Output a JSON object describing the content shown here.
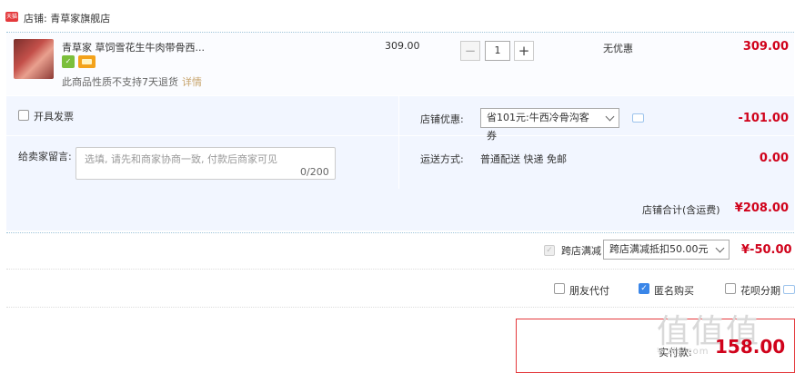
{
  "shop": {
    "icon": "shop-icon",
    "icon_text": "天猫",
    "name": "店铺: 青草家旗舰店"
  },
  "product": {
    "title": "青草家 草饲雪花生牛肉带骨西...",
    "return_note": "此商品性质不支持7天退货",
    "detail_link": "详情",
    "unit_price": "309.00",
    "quantity": "1",
    "minus": "−",
    "plus": "+",
    "discount": "无优惠",
    "row_total": "309.00"
  },
  "options": {
    "invoice_label": "开具发票",
    "shop_discount_label": "店铺优惠:",
    "shop_discount_value": "省101元:牛西冷骨沟客券",
    "shop_discount_amount": "-101.00",
    "message_label": "给卖家留言:",
    "message_placeholder": "选填, 请先和商家协商一致, 付款后商家可见",
    "message_count": "0/200",
    "shipping_label": "运送方式:",
    "shipping_value": "普通配送 快递 免邮",
    "shipping_amount": "0.00"
  },
  "subtotal": {
    "label": "店铺合计(含运费)",
    "amount": "¥208.00"
  },
  "cross_store": {
    "label": "跨店满减",
    "select_value": "跨店满减抵扣50.00元",
    "amount": "¥-50.00"
  },
  "pay_options": {
    "friend_pay": "朋友代付",
    "anonymous": "匿名购买",
    "huabei": "花呗分期"
  },
  "payment": {
    "label": "实付款:",
    "currency": "¥",
    "amount": "158.00"
  },
  "watermark": {
    "big": "值值值",
    "small": "¥ zhi.com"
  }
}
